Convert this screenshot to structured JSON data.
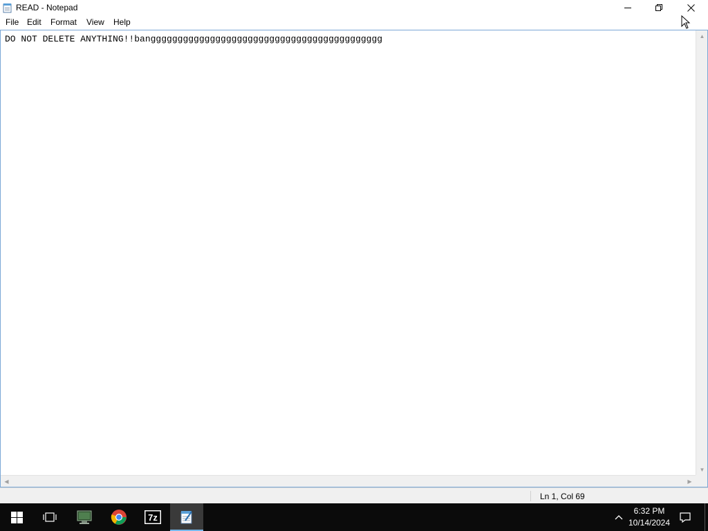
{
  "window": {
    "title": "READ - Notepad",
    "icon": "notepad-icon"
  },
  "menu": {
    "items": [
      "File",
      "Edit",
      "Format",
      "View",
      "Help"
    ]
  },
  "editor": {
    "content": "DO NOT DELETE ANYTHING!!banggggggggggggggggggggggggggggggggggggggggggg"
  },
  "status": {
    "position": "Ln 1, Col 69"
  },
  "taskbar": {
    "icons": [
      "windows-start-icon",
      "task-view-icon",
      "server-manager-icon",
      "chrome-icon",
      "7zip-icon",
      "notepad-icon"
    ],
    "sevenzip_label": "7z",
    "time": "6:32 PM",
    "date": "10/14/2024"
  },
  "colors": {
    "taskbar_bg": "#0b0b0b",
    "accent": "#76b9ed",
    "editor_border": "#7aa7d6"
  }
}
